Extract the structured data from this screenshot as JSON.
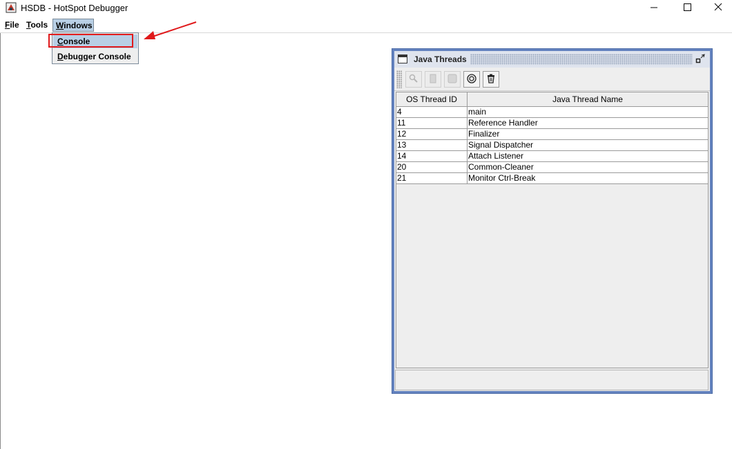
{
  "window": {
    "title": "HSDB - HotSpot Debugger"
  },
  "menubar": {
    "file": "File",
    "tools": "Tools",
    "windows": "Windows"
  },
  "dropdown": {
    "items": [
      "Console",
      "Debugger Console"
    ],
    "selected": "Console"
  },
  "annotation": {
    "color": "#e0191b"
  },
  "java_threads": {
    "title": "Java Threads",
    "columns": [
      "OS Thread ID",
      "Java Thread Name"
    ],
    "rows": [
      [
        "4",
        "main"
      ],
      [
        "11",
        "Reference Handler"
      ],
      [
        "12",
        "Finalizer"
      ],
      [
        "13",
        "Signal Dispatcher"
      ],
      [
        "14",
        "Attach Listener"
      ],
      [
        "20",
        "Common-Cleaner"
      ],
      [
        "21",
        "Monitor Ctrl-Break"
      ]
    ],
    "toolbar_icons": [
      "inspect-icon",
      "stack-memory-icon",
      "show-stack-icon",
      "find-crashes-icon",
      "trash-icon"
    ]
  },
  "colors": {
    "frame_border": "#6382bf",
    "menu_highlight": "#b8cfe5"
  }
}
